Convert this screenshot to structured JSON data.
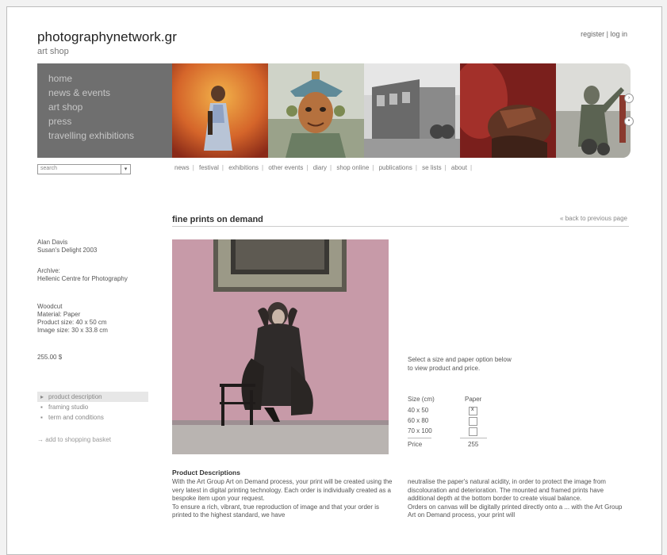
{
  "site": {
    "logo": "photographynetwork.gr",
    "subtitle": "art shop",
    "register": "register",
    "login": "log in",
    "auth_sep": "|"
  },
  "nav": {
    "items": [
      "home",
      "news & events",
      "art shop",
      "press",
      "travelling exhibitions"
    ]
  },
  "search": {
    "placeholder": "search"
  },
  "subnav": {
    "items": [
      "news",
      "festival",
      "exhibitions",
      "other events",
      "diary",
      "shop online",
      "publications",
      "se lists",
      "about"
    ]
  },
  "section": {
    "title": "fine prints on demand",
    "back": "« back to previous page"
  },
  "product": {
    "artist": "Alan Davis",
    "work": "Susan's Delight 2003",
    "archive_label": "Archive:",
    "archive": "Hellenic Centre for Photography",
    "technique": "Woodcut",
    "material": "Material: Paper",
    "product_size": "Product size: 40 x 50 cm",
    "image_size": "Image size: 30 x 33.8 cm",
    "price": "255.00 $"
  },
  "tabs": [
    {
      "label": "product description",
      "bullet": "▸"
    },
    {
      "label": "framing studio",
      "bullet": "▪"
    },
    {
      "label": "term and conditions",
      "bullet": "▪"
    }
  ],
  "add_basket": "→ add to shopping basket",
  "select_info": "Select a size and paper option below to view product and price.",
  "size_table": {
    "size_header": "Size (cm)",
    "paper_header": "Paper",
    "sizes": [
      "40 x 50",
      "60 x 80",
      "70 x 100"
    ],
    "checked_index": 0,
    "price_label": "Price",
    "price_value": "255"
  },
  "description": {
    "title": "Product Descriptions",
    "left_p1": "With the Art Group Art on Demand process, your print will be created using the very latest in digital printing technology. Each order is individually created as a bespoke item upon your request.",
    "left_p2": "To ensure a rich, vibrant, true reproduction of image and that your order is printed to the highest standard, we have",
    "right_p1": "neutralise the paper's natural acidity, in order to protect the image from discolouration and deterioration. The mounted and framed prints have additional depth at the bottom border to create visual balance.",
    "right_p2": "Orders on canvas will be digitally printed directly onto a ... with the Art Group Art on Demand process, your print will"
  },
  "colors": {
    "nav_bg": "#6f6f6f",
    "nav_text": "#c6c6c6",
    "wall_pink": "#c79aa8"
  }
}
